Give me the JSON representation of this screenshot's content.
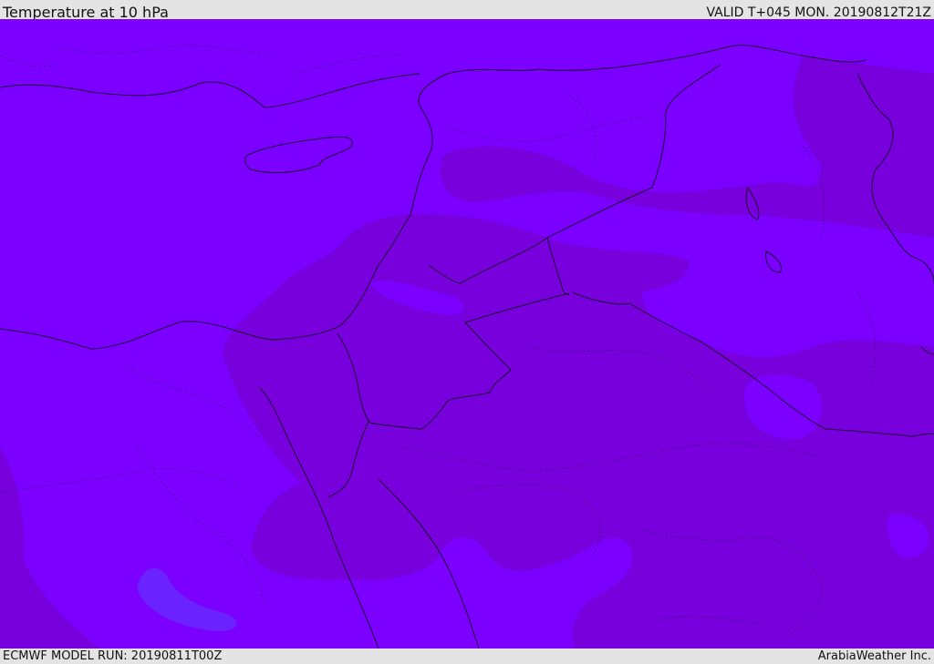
{
  "header": {
    "title": "Temperature at 10 hPa",
    "valid": "VALID T+045 MON. 20190812T21Z"
  },
  "footer": {
    "model_run": "ECMWF MODEL RUN: 20190811T00Z",
    "credit": "ArabiaWeather Inc."
  },
  "colors": {
    "field_light": "#7b00ff",
    "field_dark": "#7800dc",
    "field_cool": "#6a22ff",
    "border": "#1a0033"
  }
}
